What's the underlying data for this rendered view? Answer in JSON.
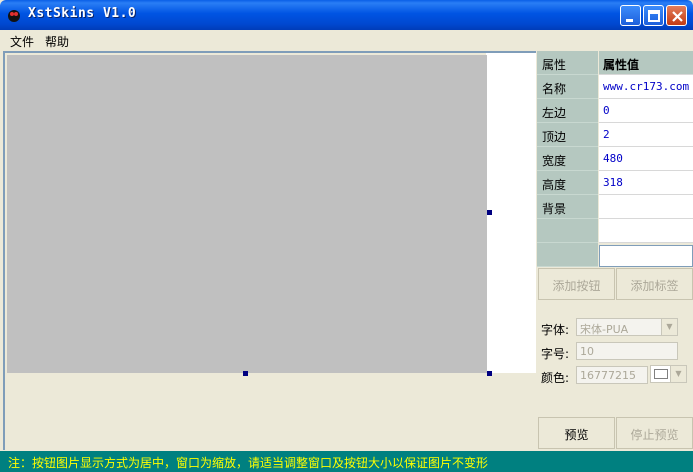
{
  "window": {
    "title": "XstSkins V1.0"
  },
  "menu": {
    "items": [
      "文件",
      "帮助"
    ]
  },
  "properties": {
    "header": {
      "name": "属性",
      "value": "属性值"
    },
    "rows": [
      {
        "name": "名称",
        "value": "www.cr173.com"
      },
      {
        "name": "左边",
        "value": "0"
      },
      {
        "name": "顶边",
        "value": "2"
      },
      {
        "name": "宽度",
        "value": "480"
      },
      {
        "name": "高度",
        "value": "318"
      },
      {
        "name": "背景",
        "value": ""
      }
    ]
  },
  "buttons": {
    "add_button": "添加按钮",
    "add_label": "添加标签",
    "preview": "预览",
    "stop_preview": "停止预览"
  },
  "font": {
    "font_label": "字体:",
    "font_value": "宋体-PUA",
    "size_label": "字号:",
    "size_value": "10",
    "color_label": "颜色:",
    "color_value": "16777215"
  },
  "status": {
    "text": "注：按钮图片显示方式为居中，窗口为缩放，请适当调整窗口及按钮大小以保证图片不变形"
  },
  "colors": {
    "status_bg": "#008080",
    "status_text": "#FFFF00",
    "handle": "#000080"
  }
}
